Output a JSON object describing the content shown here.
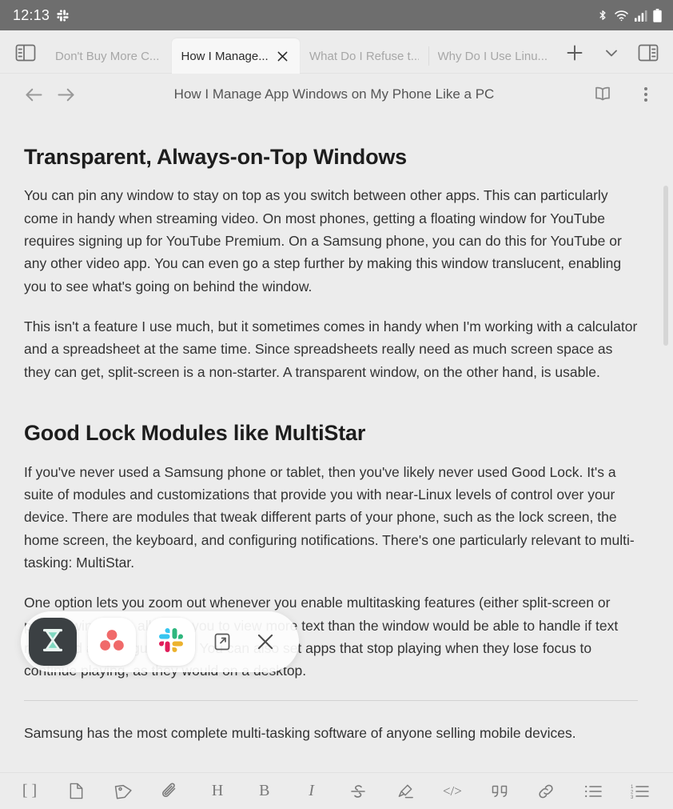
{
  "status_bar": {
    "time": "12:13",
    "left_icons": [
      "slack-notification-icon"
    ],
    "right_icons": [
      "bluetooth-icon",
      "wifi-icon",
      "cellular-signal-icon",
      "battery-icon"
    ],
    "background": "#6e6e6e",
    "text_color": "#ffffff"
  },
  "tab_strip": {
    "left_panel_button": "left-panel-toggle",
    "right_panel_button": "right-panel-toggle",
    "new_tab_label": "+",
    "tab_list_chevron": "chevron-down",
    "tabs": [
      {
        "label": "Don't Buy More C...",
        "active": false
      },
      {
        "label": "How I Manage...",
        "active": true,
        "close": "×"
      },
      {
        "label": "What Do I Refuse t...",
        "active": false
      },
      {
        "label": "Why Do I Use Linu...",
        "active": false
      }
    ]
  },
  "nav_bar": {
    "back": "back-arrow",
    "forward": "forward-arrow",
    "title": "How I Manage App Windows on My Phone Like a PC",
    "reader_mode": "reader-mode",
    "overflow_menu": "more-options"
  },
  "article": {
    "heading_1": "Transparent, Always-on-Top Windows",
    "paragraph_1": "You can pin any window to stay on top as you switch between other apps. This can particularly come in handy when streaming video. On most phones, getting a floating window for YouTube requires signing up for YouTube Premium. On a Samsung phone, you can do this for YouTube or any other video app. You can even go a step further by making this window translucent, enabling you to see what's going on behind the window.",
    "paragraph_2": "This isn't a feature I use much, but it sometimes comes in handy when I'm working with a calculator and a spreadsheet at the same time. Since spreadsheets really need as much screen space as they can get, split-screen is a non-starter. A transparent window, on the other hand, is usable.",
    "heading_2": "Good Lock Modules like MultiStar",
    "paragraph_3": "If you've never used a Samsung phone or tablet, then you've likely never used Good Lock. It's a suite of modules and customizations that provide you with near-Linux levels of control over your device. There are modules that tweak different parts of your phone, such as the lock screen, the home screen, the keyboard, and configuring notifications. There's one particularly relevant to multi-tasking: MultiStar.",
    "paragraph_4": "One option lets you zoom out whenever you enable multitasking features (either split-screen or pop-up windows), allowing you to view more text than the window would be able to handle if text remained at its regular size. You can also set apps that stop playing when they lose focus to continue playing, as they would on a desktop.",
    "paragraph_5": "Samsung has the most complete multi-tasking software of anyone selling mobile devices."
  },
  "app_dock": {
    "apps": [
      {
        "name": "good-lock",
        "icon": "hourglass-icon",
        "bg": "#3b4043",
        "fg": "#7fd8c0"
      },
      {
        "name": "asana",
        "icon": "asana-dots-icon",
        "bg": "#ffffff",
        "fg": "#f06a6a"
      },
      {
        "name": "slack",
        "icon": "slack-icon",
        "bg": "#ffffff",
        "fg": "#36c5f0"
      }
    ],
    "open_in_window_label": "open-in-window",
    "close_label": "×"
  },
  "format_bar": {
    "buttons": [
      {
        "name": "brackets",
        "glyph": "[ ]"
      },
      {
        "name": "new-note",
        "glyph": ""
      },
      {
        "name": "tag",
        "glyph": ""
      },
      {
        "name": "attachment",
        "glyph": ""
      },
      {
        "name": "heading",
        "glyph": "H"
      },
      {
        "name": "bold",
        "glyph": "B"
      },
      {
        "name": "italic",
        "glyph": "I"
      },
      {
        "name": "strikethrough",
        "glyph": "S"
      },
      {
        "name": "highlight",
        "glyph": ""
      },
      {
        "name": "code",
        "glyph": "</>"
      },
      {
        "name": "quote",
        "glyph": "””"
      },
      {
        "name": "link",
        "glyph": ""
      },
      {
        "name": "bullet-list",
        "glyph": ""
      },
      {
        "name": "numbered-list",
        "glyph": ""
      }
    ]
  },
  "colors": {
    "page_bg": "#ececec",
    "status_bg": "#6e6e6e",
    "active_tab_bg": "#f7f7f7",
    "text_primary": "#333333",
    "text_muted": "#a7a7a7"
  }
}
